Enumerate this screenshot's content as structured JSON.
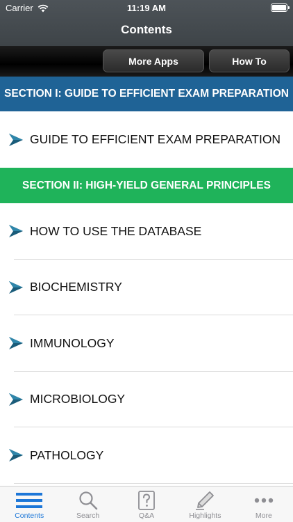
{
  "status": {
    "carrier": "Carrier",
    "time": "11:19 AM"
  },
  "nav": {
    "title": "Contents"
  },
  "toolbar": {
    "more_apps_label": "More Apps",
    "how_to_label": "How To"
  },
  "sections": [
    {
      "title": "SECTION I: GUIDE TO EFFICIENT EXAM PREPARATION",
      "color": "#1f6396",
      "items": [
        "GUIDE TO EFFICIENT EXAM PREPARATION"
      ]
    },
    {
      "title": "SECTION II: HIGH-YIELD GENERAL PRINCIPLES",
      "color": "#1fb35a",
      "items": [
        "HOW TO USE THE DATABASE",
        "BIOCHEMISTRY",
        "IMMUNOLOGY",
        "MICROBIOLOGY",
        "PATHOLOGY"
      ]
    }
  ],
  "tabs": [
    {
      "label": "Contents",
      "icon": "list-icon",
      "active": true
    },
    {
      "label": "Search",
      "icon": "search-icon",
      "active": false
    },
    {
      "label": "Q&A",
      "icon": "question-icon",
      "active": false
    },
    {
      "label": "Highlights",
      "icon": "pen-icon",
      "active": false
    },
    {
      "label": "More",
      "icon": "more-icon",
      "active": false
    }
  ],
  "colors": {
    "active_tab": "#1d77d8",
    "inactive_tab": "#8e8e93",
    "arrow": "#1a5c7a"
  }
}
